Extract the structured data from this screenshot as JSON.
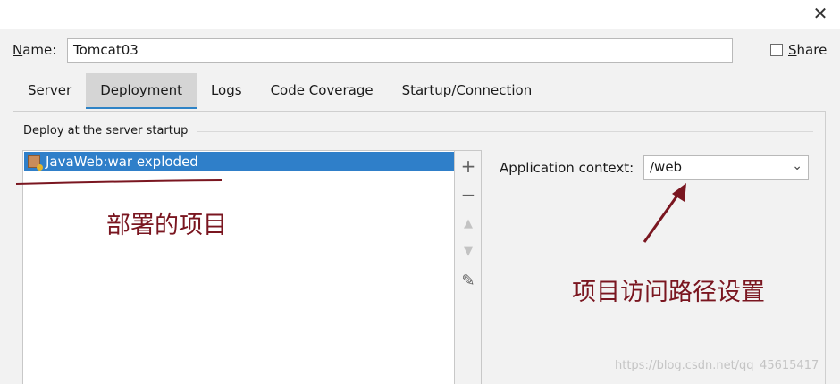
{
  "dialog": {
    "close_glyph": "✕"
  },
  "name_row": {
    "label_first": "N",
    "label_rest": "ame:",
    "value": "Tomcat03",
    "share_first": "S",
    "share_rest": "hare"
  },
  "tabs": [
    {
      "label": "Server",
      "active": false
    },
    {
      "label": "Deployment",
      "active": true
    },
    {
      "label": "Logs",
      "active": false
    },
    {
      "label": "Code Coverage",
      "active": false
    },
    {
      "label": "Startup/Connection",
      "active": false
    }
  ],
  "deploy": {
    "group_title": "Deploy at the server startup",
    "items": [
      {
        "label": "JavaWeb:war exploded",
        "icon": "artifact-icon",
        "selected": true
      }
    ],
    "toolbar": [
      {
        "name": "add-icon",
        "glyph": "+"
      },
      {
        "name": "remove-icon",
        "glyph": "−"
      },
      {
        "name": "move-up-icon",
        "glyph": "▲"
      },
      {
        "name": "move-down-icon",
        "glyph": "▼"
      },
      {
        "name": "edit-icon",
        "glyph": "✎"
      }
    ]
  },
  "app_context": {
    "label": "Application context:",
    "value": "/web",
    "chevron": "⌄"
  },
  "annotations": {
    "left_note": "部署的项目",
    "right_note": "项目访问路径设置",
    "color": "#7a1620"
  },
  "watermark": "https://blog.csdn.net/qq_45615417",
  "colors": {
    "selection": "#2f7fc9",
    "tab_active_underline": "#2e83c6"
  }
}
